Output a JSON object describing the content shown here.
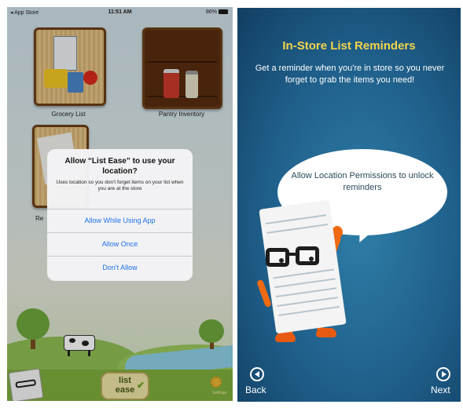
{
  "left": {
    "status_bar": {
      "carrier": "◂ App Store",
      "time": "11:51 AM",
      "battery": "86%"
    },
    "tiles": [
      {
        "label": "Grocery List"
      },
      {
        "label": "Pantry Inventory"
      },
      {
        "label": "Re"
      }
    ],
    "alert": {
      "title": "Allow “List Ease” to use your location?",
      "message": "Uses location so you don't forget items on your list when you are at the store",
      "buttons": [
        "Allow While Using App",
        "Allow Once",
        "Don't Allow"
      ]
    },
    "logo": {
      "line1": "list",
      "line2": "ease"
    },
    "settings_label": "Settings"
  },
  "right": {
    "title": "In-Store List Reminders",
    "description": "Get a reminder when you're in store so you never forget to grab the items you need!",
    "bubble_text": "Allow Location Permissions to unlock reminders",
    "nav": {
      "back": "Back",
      "next": "Next"
    }
  },
  "colors": {
    "accent_blue": "#1d72e8",
    "title_yellow": "#f5d34a",
    "right_bg": "#1f5f8a"
  }
}
